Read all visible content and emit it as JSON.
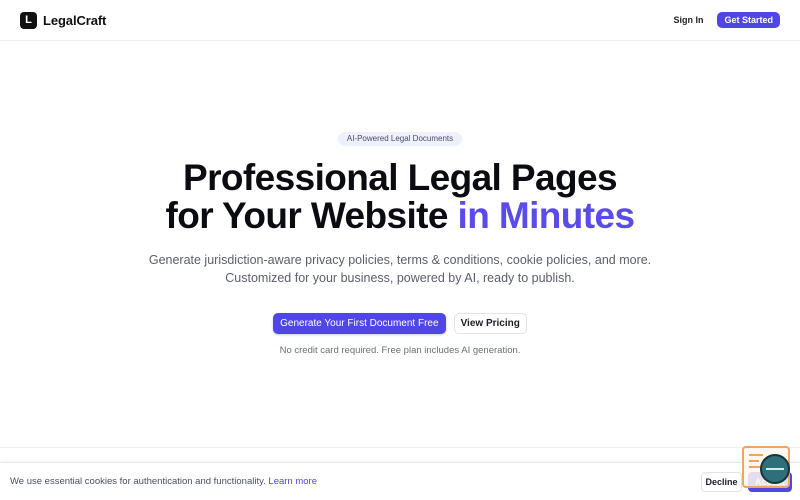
{
  "header": {
    "brand_name": "LegalCraft",
    "logo_letter": "L",
    "sign_in_label": "Sign In",
    "get_started_label": "Get Started"
  },
  "hero": {
    "badge": "AI-Powered Legal Documents",
    "title_line1": "Professional Legal Pages",
    "title_line2": "for Your Website ",
    "title_accent": "in Minutes",
    "subtitle_line1": "Generate jurisdiction-aware privacy policies, terms & conditions, cookie policies, and more.",
    "subtitle_line2": "Customized for your business, powered by AI, ready to publish.",
    "primary_cta": "Generate Your First Document Free",
    "secondary_cta": "View Pricing",
    "note": "No credit card required. Free plan includes AI generation."
  },
  "cookie_banner": {
    "text": "We use essential cookies for authentication and functionality. ",
    "link": "Learn more",
    "decline_label": "Decline",
    "accept_label": "Accept"
  },
  "colors": {
    "accent": "#4f46e5",
    "accent_text": "#5b4be8",
    "widget_border": "#f0a462",
    "widget_bubble": "#2f6f7a"
  },
  "icons": {
    "logo": "logo-square-L",
    "widget": "chat-widget-icon"
  }
}
